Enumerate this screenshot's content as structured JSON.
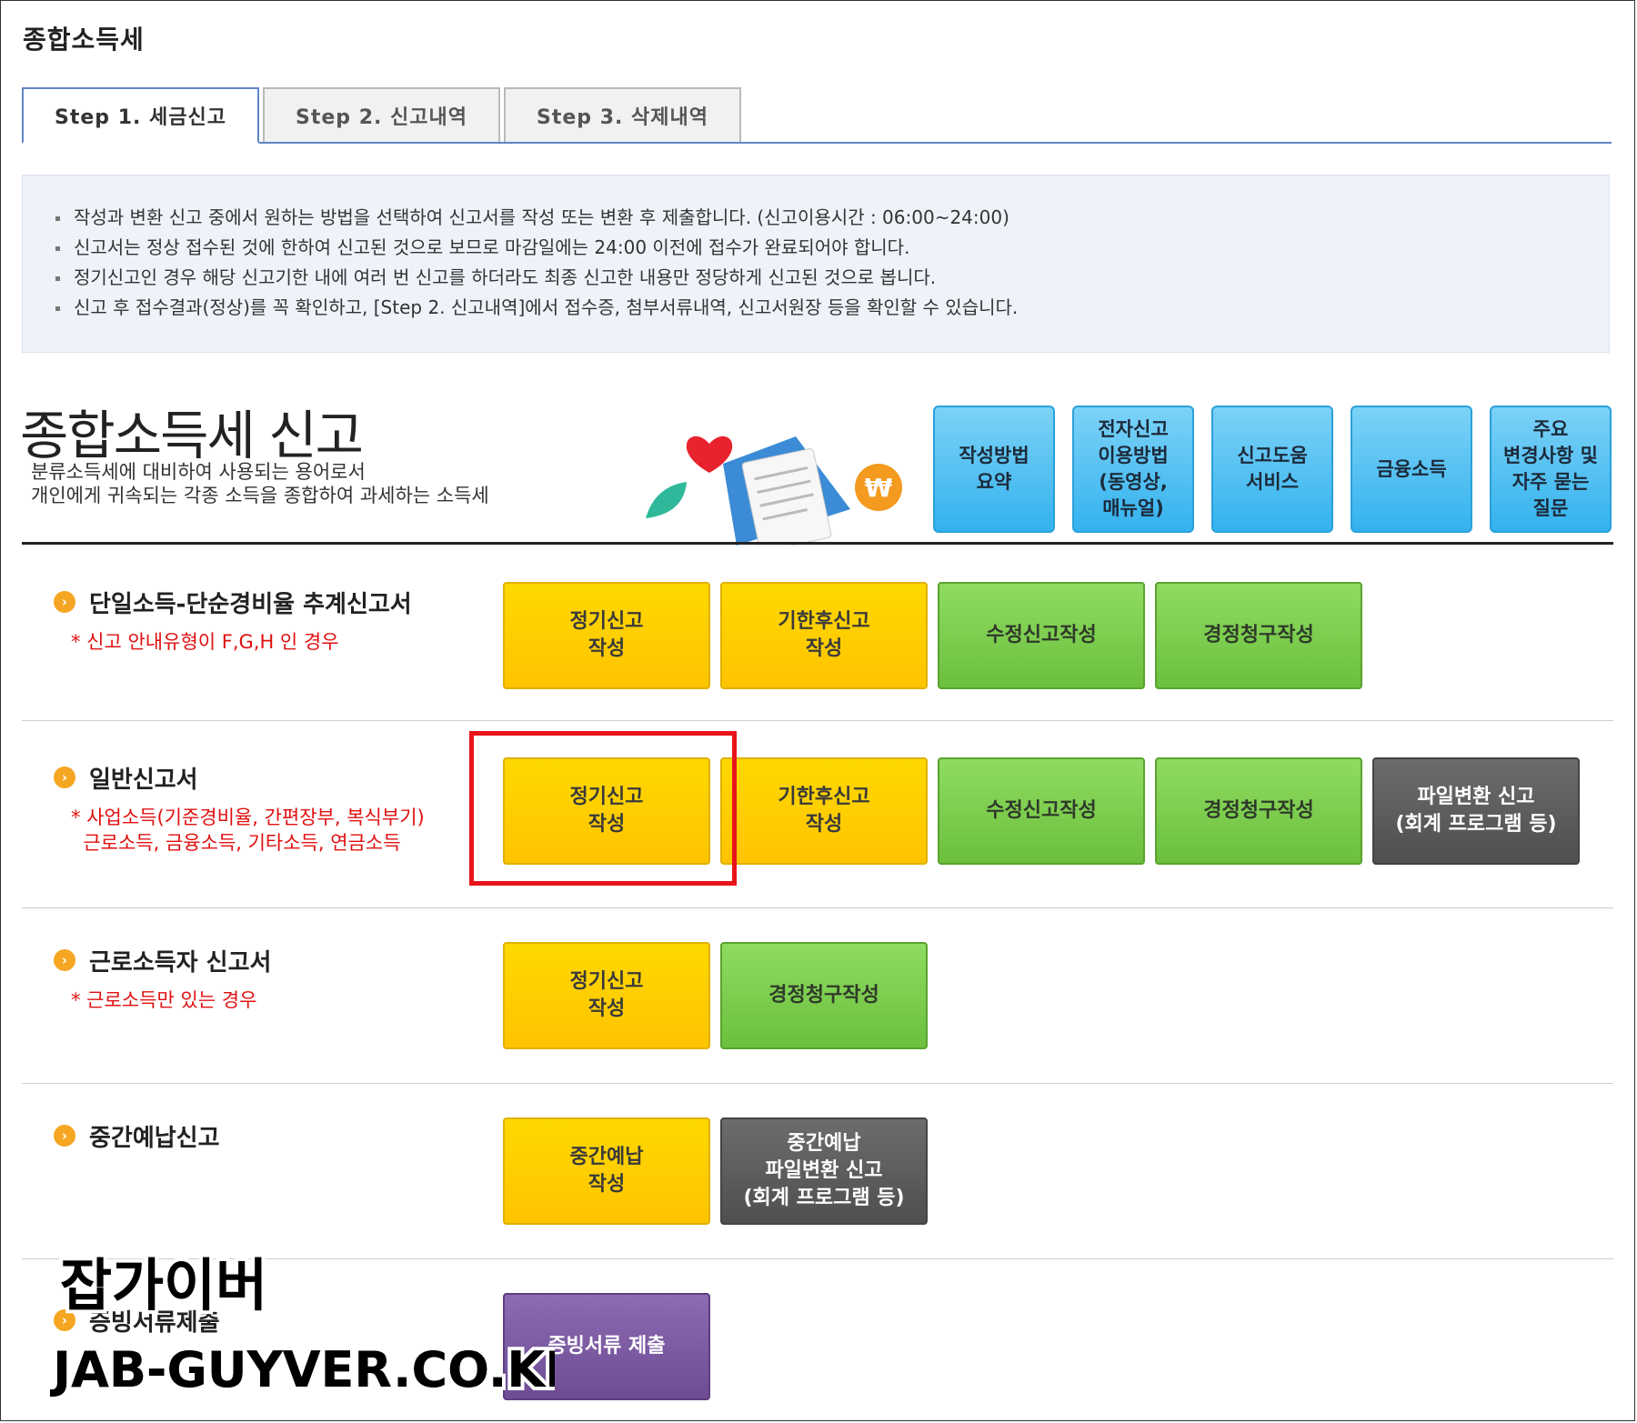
{
  "page_title": "종합소득세",
  "tabs": [
    {
      "label": "Step 1. 세금신고",
      "active": true
    },
    {
      "label": "Step 2. 신고내역",
      "active": false
    },
    {
      "label": "Step 3. 삭제내역",
      "active": false
    }
  ],
  "notice": [
    "작성과 변환 신고 중에서 원하는 방법을 선택하여 신고서를 작성 또는 변환 후 제출합니다. (신고이용시간 : 06:00~24:00)",
    "신고서는 정상 접수된 것에 한하여 신고된 것으로 보므로 마감일에는 24:00 이전에 접수가 완료되어야 합니다.",
    "정기신고인 경우 해당 신고기한 내에 여러 번 신고를 하더라도 최종 신고한 내용만 정당하게 신고된 것으로 봅니다.",
    "신고 후 접수결과(정상)를 꼭 확인하고, [Step 2. 신고내역]에서 접수증, 첨부서류내역, 신고서원장 등을 확인할 수 있습니다."
  ],
  "hero": {
    "title": "종합소득세 신고",
    "desc_line1": "분류소득세에 대비하여 사용되는 용어로서",
    "desc_line2": "개인에게 귀속되는 각종 소득을 종합하여 과세하는 소득세"
  },
  "quick_buttons": [
    "작성방법\n요약",
    "전자신고\n이용방법\n(동영상,\n매뉴얼)",
    "신고도움\n서비스",
    "금융소득",
    "주요\n변경사항 및\n자주 묻는\n질문"
  ],
  "sections": [
    {
      "title": "단일소득-단순경비율 추계신고서",
      "note": "* 신고 안내유형이 F,G,H 인 경우",
      "buttons": [
        "정기신고\n작성",
        "기한후신고\n작성",
        "수정신고작성",
        "경정청구작성"
      ]
    },
    {
      "title": "일반신고서",
      "note": "* 사업소득(기준경비율, 간편장부, 복식부기)\n  근로소득, 금융소득, 기타소득, 연금소득",
      "buttons": [
        "정기신고\n작성",
        "기한후신고\n작성",
        "수정신고작성",
        "경정청구작성",
        "파일변환 신고\n(회계 프로그램 등)"
      ]
    },
    {
      "title": "근로소득자 신고서",
      "note": "* 근로소득만 있는 경우",
      "buttons": [
        "정기신고\n작성",
        "경정청구작성"
      ]
    },
    {
      "title": "중간예납신고",
      "note": "",
      "buttons": [
        "중간예납\n작성",
        "중간예납\n파일변환 신고\n(회계 프로그램 등)"
      ]
    },
    {
      "title": "증빙서류제출",
      "note": "",
      "buttons": [
        "증빙서류 제출"
      ]
    }
  ],
  "watermark": {
    "line1": "잡가이버",
    "line2": "JAB-GUYVER.CO.KR"
  },
  "colors": {
    "tab_border": "#5f86c4",
    "yellow_button": "#ffd000",
    "green_button": "#7ccd4f",
    "gray_button": "#5c5c5c",
    "purple_button": "#7b5aa3",
    "quick_button": "#4cbdf2",
    "highlight": "#e8141b",
    "note_red": "#e01010"
  }
}
